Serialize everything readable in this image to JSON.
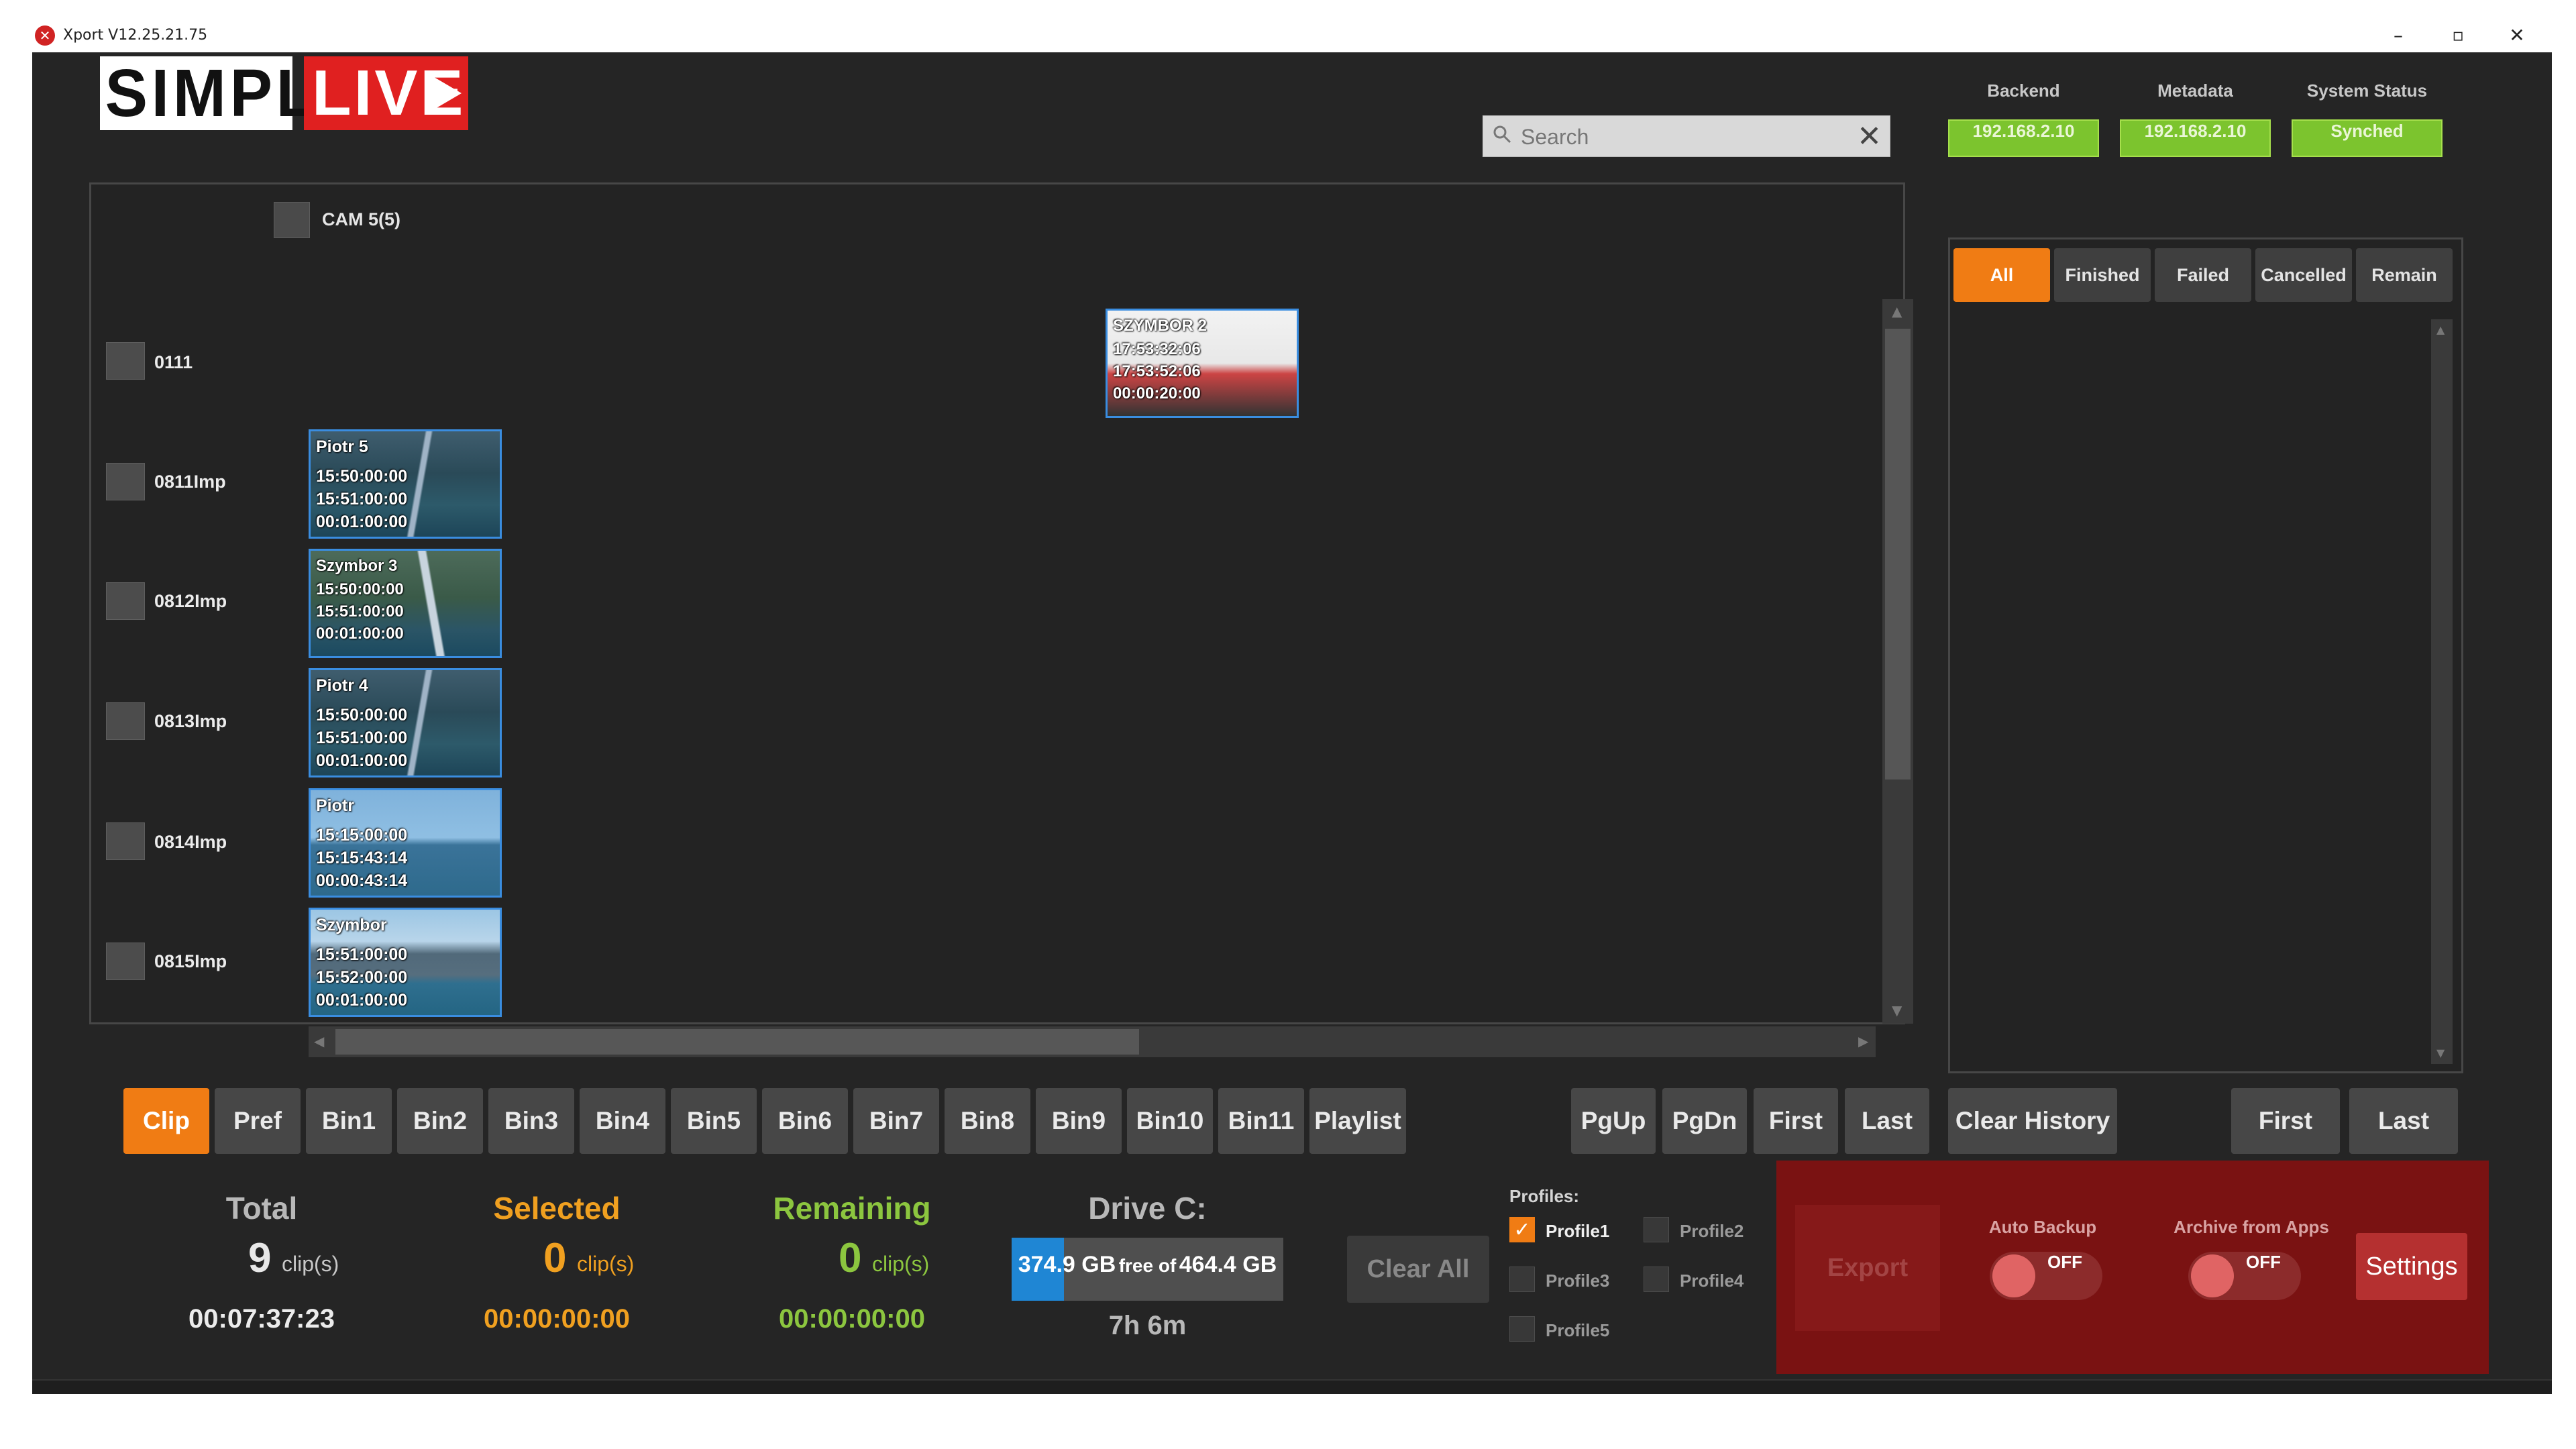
{
  "window": {
    "title": "Xport V12.25.21.75",
    "min": "–",
    "max": "▫",
    "close": "✕"
  },
  "logo": {
    "simply": "SIMPLY",
    "live": "LIVE"
  },
  "search": {
    "placeholder": "Search",
    "value": "",
    "clear": "✕"
  },
  "status": [
    {
      "label": "Backend",
      "value": "192.168.2.10"
    },
    {
      "label": "Metadata",
      "value": "192.168.2.10"
    },
    {
      "label": "System Status",
      "value": "Synched"
    }
  ],
  "camera": {
    "label": "CAM 5(5)"
  },
  "rows": [
    {
      "label": "0111"
    },
    {
      "label": "0811Imp"
    },
    {
      "label": "0812Imp"
    },
    {
      "label": "0813Imp"
    },
    {
      "label": "0814Imp"
    },
    {
      "label": "0815Imp"
    }
  ],
  "clips": [
    {
      "name": "SZYMBOR 2",
      "tc_in": "17:53:32:06",
      "tc_out": "17:53:52:06",
      "duration": "00:00:20:00"
    },
    {
      "name": "Piotr 5",
      "tc_in": "15:50:00:00",
      "tc_out": "15:51:00:00",
      "duration": "00:01:00:00"
    },
    {
      "name": "Szymbor 3",
      "tc_in": "15:50:00:00",
      "tc_out": "15:51:00:00",
      "duration": "00:01:00:00"
    },
    {
      "name": "Piotr 4",
      "tc_in": "15:50:00:00",
      "tc_out": "15:51:00:00",
      "duration": "00:01:00:00"
    },
    {
      "name": "Piotr",
      "tc_in": "15:15:00:00",
      "tc_out": "15:15:43:14",
      "duration": "00:00:43:14"
    },
    {
      "name": "Szymbor",
      "tc_in": "15:51:00:00",
      "tc_out": "15:52:00:00",
      "duration": "00:01:00:00"
    }
  ],
  "filters": [
    {
      "label": "All",
      "active": true
    },
    {
      "label": "Finished"
    },
    {
      "label": "Failed"
    },
    {
      "label": "Cancelled"
    },
    {
      "label": "Remain"
    }
  ],
  "toolbar": {
    "tabs": [
      "Clip",
      "Pref",
      "Bin1",
      "Bin2",
      "Bin3",
      "Bin4",
      "Bin5",
      "Bin6",
      "Bin7",
      "Bin8",
      "Bin9",
      "Bin10",
      "Bin11",
      "Playlist"
    ],
    "active_tab": "Clip",
    "pgup": "PgUp",
    "pgdn": "PgDn",
    "first": "First",
    "last": "Last",
    "clear_history": "Clear History",
    "history_first": "First",
    "history_last": "Last"
  },
  "stats": {
    "total": {
      "label": "Total",
      "count": "9",
      "unit": "clip(s)",
      "time": "00:07:37:23"
    },
    "selected": {
      "label": "Selected",
      "count": "0",
      "unit": "clip(s)",
      "time": "00:00:00:00"
    },
    "remaining": {
      "label": "Remaining",
      "count": "0",
      "unit": "clip(s)",
      "time": "00:00:00:00"
    }
  },
  "drive": {
    "label": "Drive C:",
    "free": "374.9 GB",
    "free_of": "free of",
    "total": "464.4 GB",
    "used_fraction": 0.193,
    "time_left": "7h 6m"
  },
  "clear_all": "Clear All",
  "profiles": {
    "title": "Profiles:",
    "items": [
      {
        "label": "Profile1",
        "checked": true
      },
      {
        "label": "Profile2",
        "checked": false
      },
      {
        "label": "Profile3",
        "checked": false
      },
      {
        "label": "Profile4",
        "checked": false
      },
      {
        "label": "Profile5",
        "checked": false
      }
    ]
  },
  "export": {
    "label": "Export",
    "auto_backup": {
      "label": "Auto Backup",
      "state": "OFF"
    },
    "archive": {
      "label": "Archive from Apps",
      "state": "OFF"
    },
    "settings": "Settings"
  },
  "colors": {
    "accent": "#f07c14",
    "status_green": "#7cc42e",
    "clip_border": "#3a8de0",
    "danger": "#7a1212"
  }
}
